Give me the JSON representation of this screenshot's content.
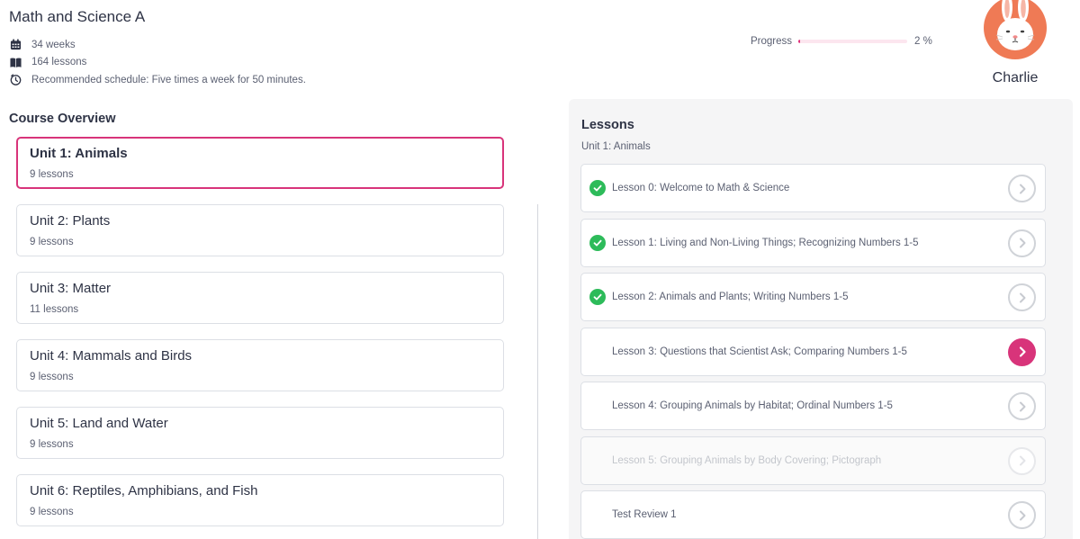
{
  "course": {
    "title": "Math and Science A",
    "meta": [
      {
        "icon": "calendar-icon",
        "text": "34 weeks"
      },
      {
        "icon": "book-icon",
        "text": "164 lessons"
      },
      {
        "icon": "timer-icon",
        "text": "Recommended schedule: Five times a week for 50 minutes."
      }
    ]
  },
  "progress": {
    "label": "Progress",
    "percent_text": "2 %",
    "value": 2
  },
  "user": {
    "name": "Charlie",
    "avatar_icon": "bunny-avatar-icon"
  },
  "overview": {
    "title": "Course Overview",
    "units": [
      {
        "title": "Unit 1: Animals",
        "count": "9 lessons",
        "active": true
      },
      {
        "title": "Unit 2: Plants",
        "count": "9 lessons"
      },
      {
        "title": "Unit 3: Matter",
        "count": "11 lessons"
      },
      {
        "title": "Unit 4: Mammals and Birds",
        "count": "9 lessons"
      },
      {
        "title": "Unit 5: Land and Water",
        "count": "9 lessons"
      },
      {
        "title": "Unit 6: Reptiles, Amphibians, and Fish",
        "count": "9 lessons"
      }
    ]
  },
  "lessons": {
    "title": "Lessons",
    "unit_label": "Unit 1: Animals",
    "items": [
      {
        "label": "Lesson 0: Welcome to Math & Science",
        "state": "completed"
      },
      {
        "label": "Lesson 1: Living and Non-Living Things; Recognizing Numbers 1-5",
        "state": "completed"
      },
      {
        "label": "Lesson 2: Animals and Plants; Writing Numbers 1-5",
        "state": "completed"
      },
      {
        "label": "Lesson 3: Questions that Scientist Ask; Comparing Numbers 1-5",
        "state": "current"
      },
      {
        "label": "Lesson 4: Grouping Animals by Habitat; Ordinal Numbers 1-5",
        "state": "available"
      },
      {
        "label": "Lesson 5: Grouping Animals by Body Covering; Pictograph",
        "state": "locked"
      },
      {
        "label": "Test Review 1",
        "state": "available"
      }
    ]
  },
  "colors": {
    "accent": "#d8347a",
    "success": "#2dbb5a",
    "avatar_bg": "#ef7a55"
  }
}
